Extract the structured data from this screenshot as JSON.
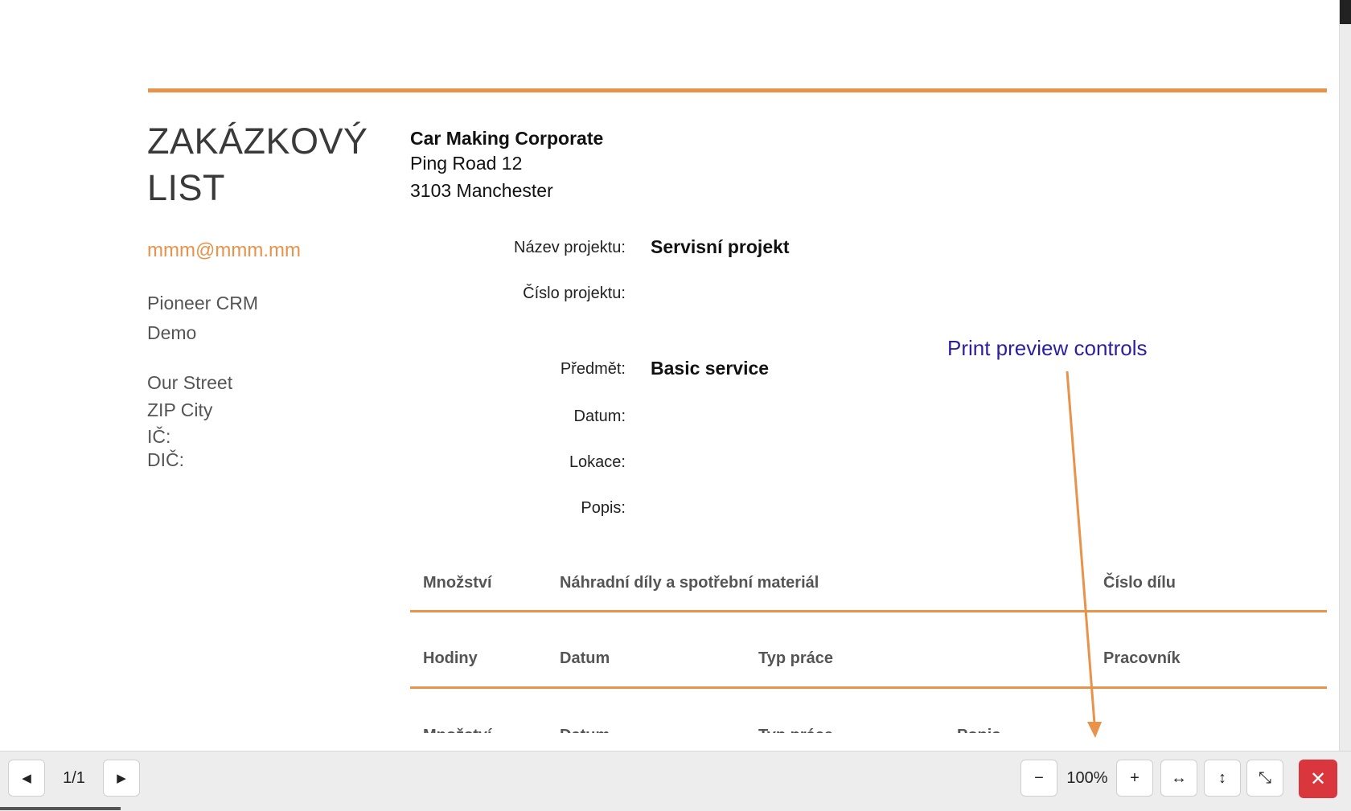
{
  "document": {
    "title_line1": "ZAKÁZKOVÝ",
    "title_line2": "LIST",
    "email": "mmm@mmm.mm",
    "sender_line1": "Pioneer CRM",
    "sender_line2": "Demo",
    "address_line1": "Our Street",
    "address_line2": "ZIP City",
    "ic_label": "IČ:",
    "dic_label": "DIČ:",
    "customer_name": "Car Making Corporate",
    "customer_street": "Ping Road 12",
    "customer_city": "3103 Manchester",
    "fields": {
      "project_name_label": "Název projektu:",
      "project_name_value": "Servisní projekt",
      "project_number_label": "Číslo projektu:",
      "subject_label": "Předmět:",
      "subject_value": "Basic service",
      "date_label": "Datum:",
      "location_label": "Lokace:",
      "description_label": "Popis:"
    },
    "parts_table": {
      "col1": "Množství",
      "col2": "Náhradní díly a spotřební materiál",
      "col3": "Číslo dílu"
    },
    "work_table": {
      "col1": "Hodiny",
      "col2": "Datum",
      "col3": "Typ práce",
      "col4": "Pracovník"
    },
    "cut_row": {
      "col1": "Množství",
      "col2": "Datum",
      "col3": "Typ práce",
      "col4": "Popis"
    }
  },
  "annotation": {
    "label": "Print preview controls",
    "color": "#2b1fa0",
    "arrow_color": "#e8924a"
  },
  "toolbar": {
    "prev_icon": "◀",
    "page_indicator": "1/1",
    "next_icon": "▶",
    "zoom_out_icon": "−",
    "zoom_level": "100%",
    "zoom_in_icon": "+",
    "fit_width_icon": "↔",
    "fit_height_icon": "↕",
    "fit_page_icon": "⤡",
    "close_icon": "✕"
  },
  "colors": {
    "accent": "#e8924a",
    "close": "#d9363e"
  }
}
